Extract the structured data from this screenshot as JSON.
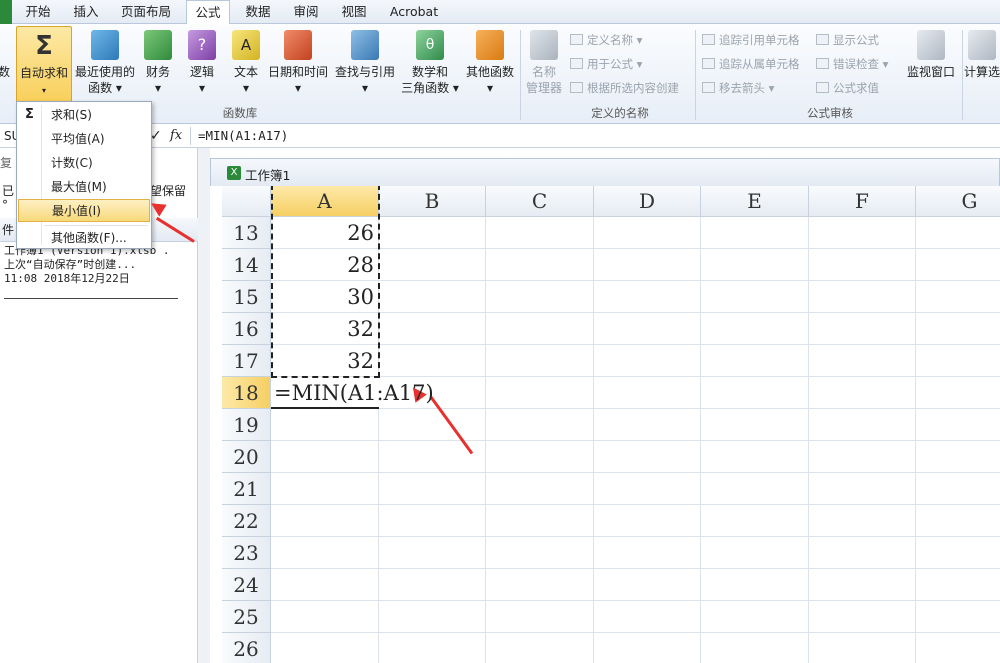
{
  "ribbon_tabs": {
    "home": "开始",
    "insert": "插入",
    "page_layout": "页面布局",
    "formulas": "公式",
    "data": "数据",
    "review": "审阅",
    "view": "视图",
    "acrobat": "Acrobat"
  },
  "function_library": {
    "group_label": "函数库",
    "insert_fn_partial": "数",
    "autosum": "自动求和",
    "recent_1": "最近使用的",
    "recent_2": "函数",
    "financial": "财务",
    "logical": "逻辑",
    "text": "文本",
    "datetime": "日期和时间",
    "lookup": "查找与引用",
    "math_1": "数学和",
    "math_2": "三角函数",
    "more": "其他函数"
  },
  "defined_names": {
    "group_label": "定义的名称",
    "name_manager_1": "名称",
    "name_manager_2": "管理器",
    "define_name": "定义名称",
    "use_in_formula": "用于公式",
    "create_from_selection": "根据所选内容创建"
  },
  "formula_auditing": {
    "group_label": "公式审核",
    "trace_precedents": "追踪引用单元格",
    "trace_dependents": "追踪从属单元格",
    "remove_arrows": "移去箭头",
    "show_formulas": "显示公式",
    "error_checking": "错误检查",
    "evaluate_formula": "公式求值",
    "watch_window": "监视窗口",
    "calc_options_partial": "计算选"
  },
  "formula_bar": {
    "name_box": "SU",
    "fx": "fx",
    "formula": "=MIN(A1:A17)"
  },
  "autosum_menu": [
    "求和(S)",
    "平均值(A)",
    "计数(C)",
    "最大值(M)",
    "最小值(I)",
    "其他函数(F)..."
  ],
  "left_panel": {
    "row1": "复",
    "row2a": "已",
    "row2b": "望保留",
    "row3": "°",
    "row4": "件",
    "file_line1": "工作簿1 (Version 1).xlsb .",
    "file_line2": "上次“自动保存”时创建...",
    "file_line3": "11:08 2018年12月22日"
  },
  "workbook": {
    "title": "工作簿1"
  },
  "grid": {
    "columns": [
      "A",
      "B",
      "C",
      "D",
      "E",
      "F",
      "G"
    ],
    "rows": [
      {
        "num": "13",
        "a": "26"
      },
      {
        "num": "14",
        "a": "28"
      },
      {
        "num": "15",
        "a": "30"
      },
      {
        "num": "16",
        "a": "32"
      },
      {
        "num": "17",
        "a": "32"
      },
      {
        "num": "18",
        "a": "=MIN(A1:A17)"
      },
      {
        "num": "19",
        "a": ""
      },
      {
        "num": "20",
        "a": ""
      },
      {
        "num": "21",
        "a": ""
      },
      {
        "num": "22",
        "a": ""
      },
      {
        "num": "23",
        "a": ""
      },
      {
        "num": "24",
        "a": ""
      },
      {
        "num": "25",
        "a": ""
      },
      {
        "num": "26",
        "a": ""
      }
    ]
  },
  "colors": {
    "accent": "#f6cf63",
    "arrow": "#e8302e",
    "excel_green": "#2a8a3a"
  }
}
